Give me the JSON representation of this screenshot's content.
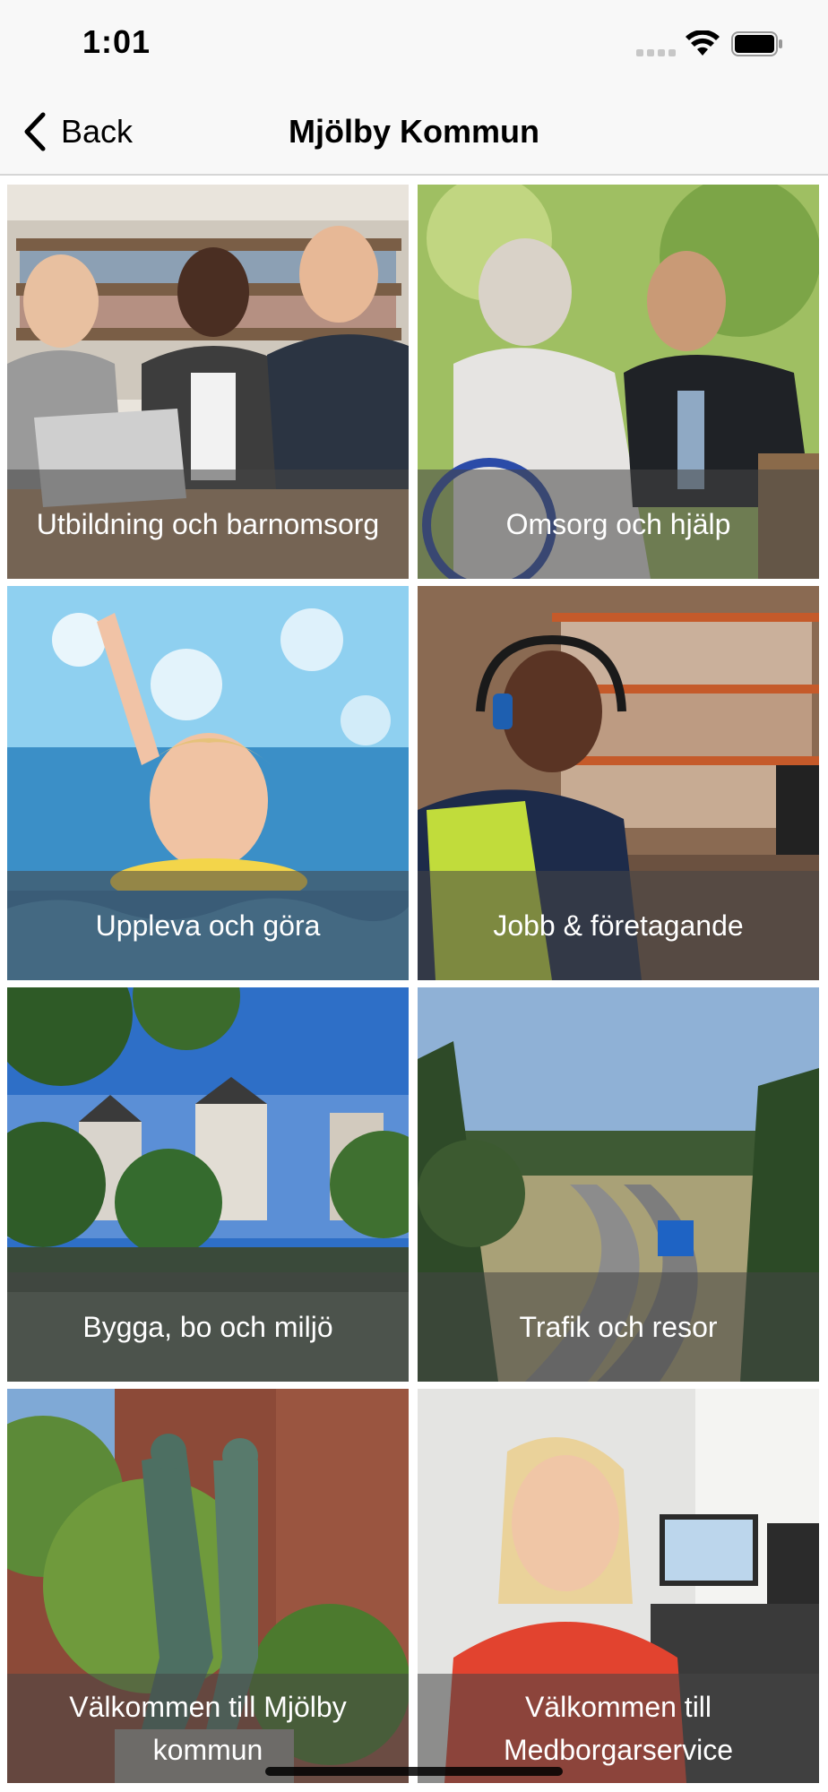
{
  "status_bar": {
    "time": "1:01"
  },
  "nav": {
    "back_label": "Back",
    "title": "Mjölby Kommun"
  },
  "tiles": [
    {
      "label": "Utbildning och barnomsorg",
      "image": "students-at-laptop-photo"
    },
    {
      "label": "Omsorg och hjälp",
      "image": "elderly-care-photo"
    },
    {
      "label": "Uppleva och göra",
      "image": "child-swimming-photo"
    },
    {
      "label": "Jobb & företagande",
      "image": "warehouse-worker-photo"
    },
    {
      "label": "Bygga, bo och miljö",
      "image": "river-buildings-photo"
    },
    {
      "label": "Trafik och resor",
      "image": "highway-photo"
    },
    {
      "label": "Välkommen till Mjölby\nkommun",
      "image": "statue-photo"
    },
    {
      "label": "Välkommen till\nMedborgarservice",
      "image": "service-agent-photo"
    }
  ]
}
